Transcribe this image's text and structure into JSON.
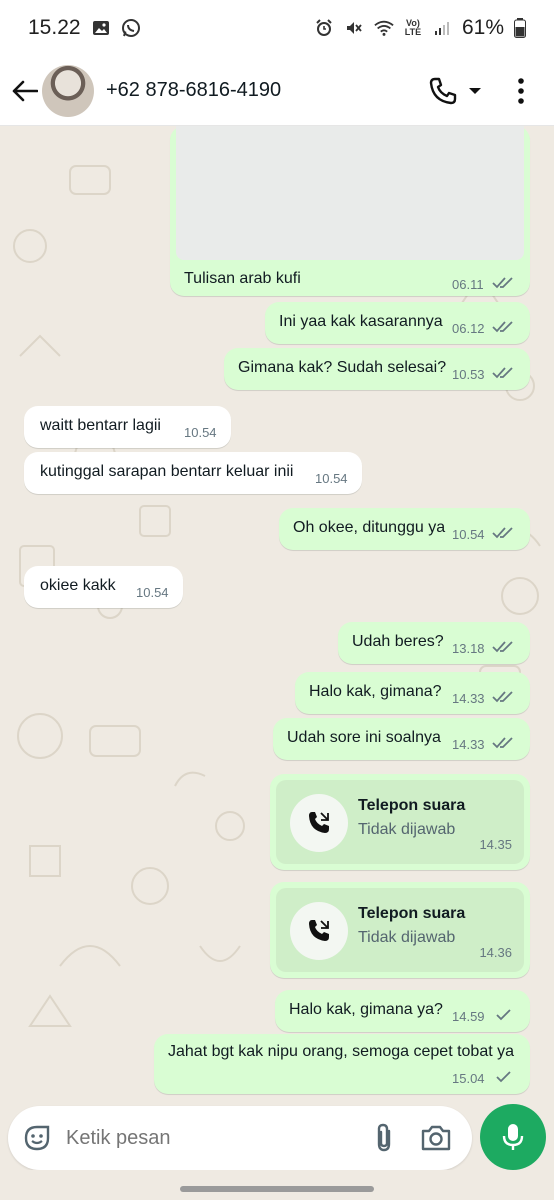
{
  "status_bar": {
    "time": "15.22",
    "battery": "61%",
    "network": "Vo) LTE"
  },
  "header": {
    "contact": "+62 878-6816-4190"
  },
  "messages": [
    {
      "text": "Tulisan arab kufi",
      "time": "06.11",
      "dir": "out",
      "status": "read"
    },
    {
      "text": "Ini yaa kak kasarannya",
      "time": "06.12",
      "dir": "out",
      "status": "read"
    },
    {
      "text": "Gimana kak? Sudah selesai?",
      "time": "10.53",
      "dir": "out",
      "status": "read"
    },
    {
      "text": "waitt bentarr lagii",
      "time": "10.54",
      "dir": "in"
    },
    {
      "text": "kutinggal sarapan bentarr keluar inii",
      "time": "10.54",
      "dir": "in"
    },
    {
      "text": "Oh okee, ditunggu ya",
      "time": "10.54",
      "dir": "out",
      "status": "read"
    },
    {
      "text": "okiee kakk",
      "time": "10.54",
      "dir": "in"
    },
    {
      "text": "Udah beres?",
      "time": "13.18",
      "dir": "out",
      "status": "read"
    },
    {
      "text": "Halo kak, gimana?",
      "time": "14.33",
      "dir": "out",
      "status": "read"
    },
    {
      "text": "Udah sore ini soalnya",
      "time": "14.33",
      "dir": "out",
      "status": "read"
    },
    {
      "text": "Halo kak, gimana ya?",
      "time": "14.59",
      "dir": "out",
      "status": "sent"
    },
    {
      "text": "Jahat bgt kak nipu orang, semoga cepet tobat ya",
      "time": "15.04",
      "dir": "out",
      "status": "sent"
    }
  ],
  "calls": [
    {
      "title": "Telepon suara",
      "status": "Tidak dijawab",
      "time": "14.35"
    },
    {
      "title": "Telepon suara",
      "status": "Tidak dijawab",
      "time": "14.36"
    }
  ],
  "input": {
    "placeholder": "Ketik pesan"
  },
  "colors": {
    "outgoing_bubble": "#d9fdd3",
    "incoming_bubble": "#ffffff",
    "chat_background": "#efeae2",
    "read_ticks": "#667781",
    "mic_button": "#1daa61"
  },
  "icons": [
    "back-arrow-icon",
    "phone-icon",
    "dropdown-caret-icon",
    "more-vert-icon",
    "sticker-icon",
    "attach-icon",
    "camera-icon",
    "mic-icon",
    "call-icon"
  ]
}
